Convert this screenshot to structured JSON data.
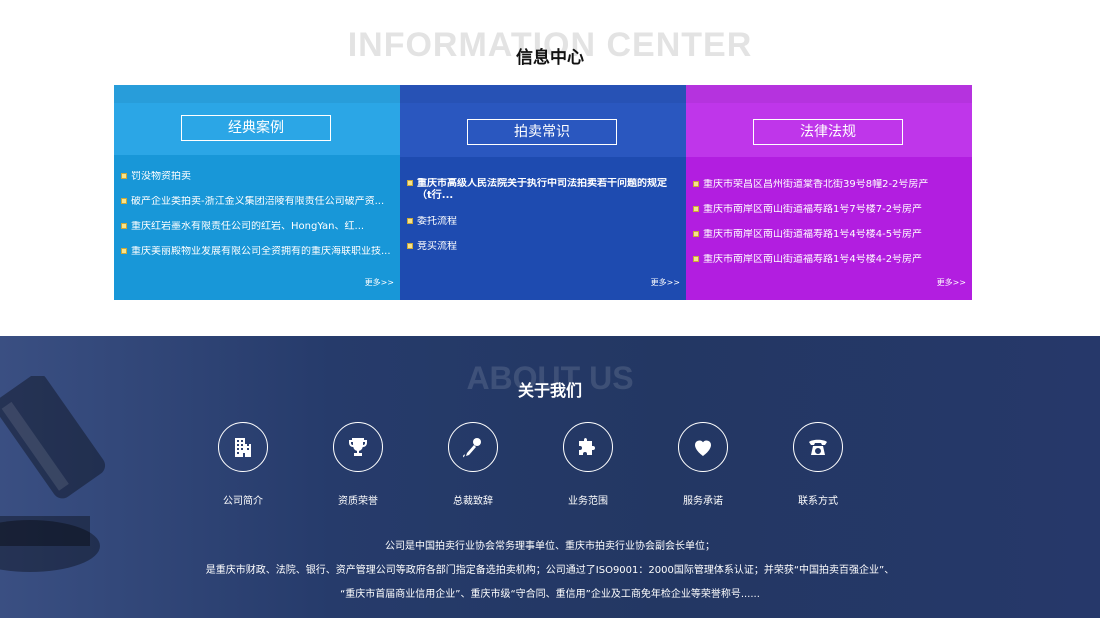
{
  "info": {
    "bg_title": "INFORMATION CENTER",
    "title": "信息中心",
    "columns": [
      {
        "title": "经典案例",
        "items": [
          "罚没物资拍卖",
          "破产企业类拍卖-浙江金义集团涪陵有限责任公司破产资...",
          "重庆红岩墨水有限责任公司的红岩、HongYan、红...",
          "重庆美丽殿物业发展有限公司全资拥有的重庆海联职业技..."
        ],
        "more": "更多>>"
      },
      {
        "title": "拍卖常识",
        "items": [
          "重庆市高级人民法院关于执行中司法拍卖若干问题的规定（t行...",
          "委托流程",
          "竞买流程"
        ],
        "more": "更多>>"
      },
      {
        "title": "法律法规",
        "items": [
          "重庆市荣昌区昌州街道棠香北街39号8幢2-2号房产",
          "重庆市南岸区南山街道福寿路1号7号楼7-2号房产",
          "重庆市南岸区南山街道福寿路1号4号楼4-5号房产",
          "重庆市南岸区南山街道福寿路1号4号楼4-2号房产"
        ],
        "more": "更多>>"
      }
    ]
  },
  "about": {
    "bg_title": "ABOUT US",
    "title": "关于我们",
    "links": [
      {
        "label": "公司简介",
        "icon": "building-icon"
      },
      {
        "label": "资质荣誉",
        "icon": "trophy-icon"
      },
      {
        "label": "总裁致辞",
        "icon": "microphone-icon"
      },
      {
        "label": "业务范围",
        "icon": "puzzle-icon"
      },
      {
        "label": "服务承诺",
        "icon": "heart-icon"
      },
      {
        "label": "联系方式",
        "icon": "telephone-icon"
      }
    ],
    "description": [
      "公司是中国拍卖行业协会常务理事单位、重庆市拍卖行业协会副会长单位；",
      "是重庆市财政、法院、银行、资产管理公司等政府各部门指定备选拍卖机构；公司通过了ISO9001：2000国际管理体系认证；并荣获“中国拍卖百强企业”、",
      "“重庆市首届商业信用企业”、重庆市级“守合同、重信用”企业及工商免年检企业等荣誉称号......"
    ]
  }
}
